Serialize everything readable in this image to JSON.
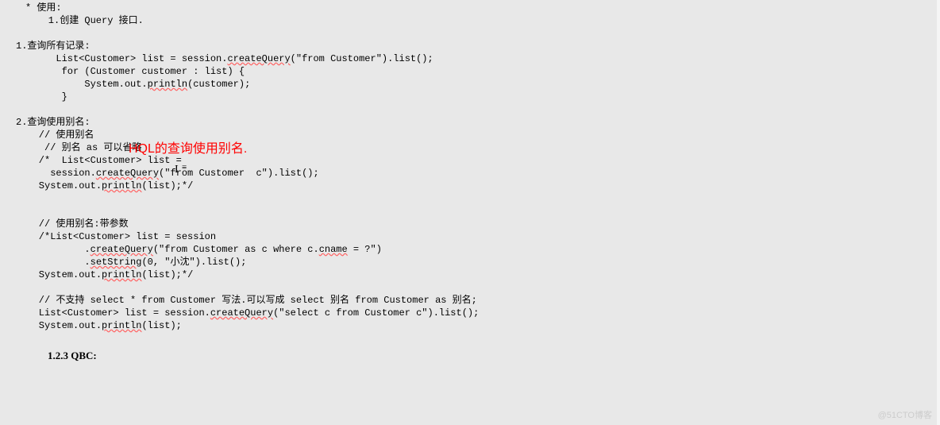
{
  "top_fragment": "",
  "usage": {
    "star_line": "* 使用:",
    "sub1": "    1.创建 Query 接口."
  },
  "section1": {
    "title": "1.查询所有记录:",
    "l1": "       List<Customer> list = session.",
    "l1_sq": "createQuery",
    "l1_tail": "(\"from Customer\").list();",
    "l2": "        for (Customer customer : list) {",
    "l3": "            System.out.",
    "l3_sq": "println",
    "l3_tail": "(customer);",
    "l4": "        }"
  },
  "annotation_text": "HQL的查询使用别名.",
  "section2": {
    "title": "2.查询使用别名:",
    "l1": "    // 使用别名",
    "l2": "     // 别名 as 可以省略",
    "l3": "    /*  List<Customer> list =",
    "l4a": "      session.",
    "l4_sq": "createQuery",
    "l4b": "(\"from Customer  c\").list();",
    "l5a": "    System.out.",
    "l5_sq": "println",
    "l5b": "(list);*/"
  },
  "block2": {
    "l1": "    // 使用别名:带参数",
    "l2": "    /*List<Customer> list = session",
    "l3a": "            .",
    "l3_sq": "createQuery",
    "l3b": "(\"from Customer as c where c.",
    "l3_sq2": "cname",
    "l3c": " = ?\")",
    "l4a": "            .",
    "l4_sq": "setString",
    "l4b": "(0, \"小沈\").list();",
    "l5a": "    System.out.",
    "l5_sq": "println",
    "l5b": "(list);*/"
  },
  "block3": {
    "l1": "    // 不支持 select * from Customer 写法.可以写成 select 别名 from Customer as 别名;",
    "l2a": "    List<Customer> list = session.",
    "l2_sq": "createQuery",
    "l2b": "(\"select c from Customer c\").list();",
    "l3a": "    System.out.",
    "l3_sq": "println",
    "l3b": "(list);"
  },
  "heading": "1.2.3    QBC:",
  "cursor_glyph": "I",
  "cursor_mark2": "≡",
  "watermark": "@51CTO博客"
}
